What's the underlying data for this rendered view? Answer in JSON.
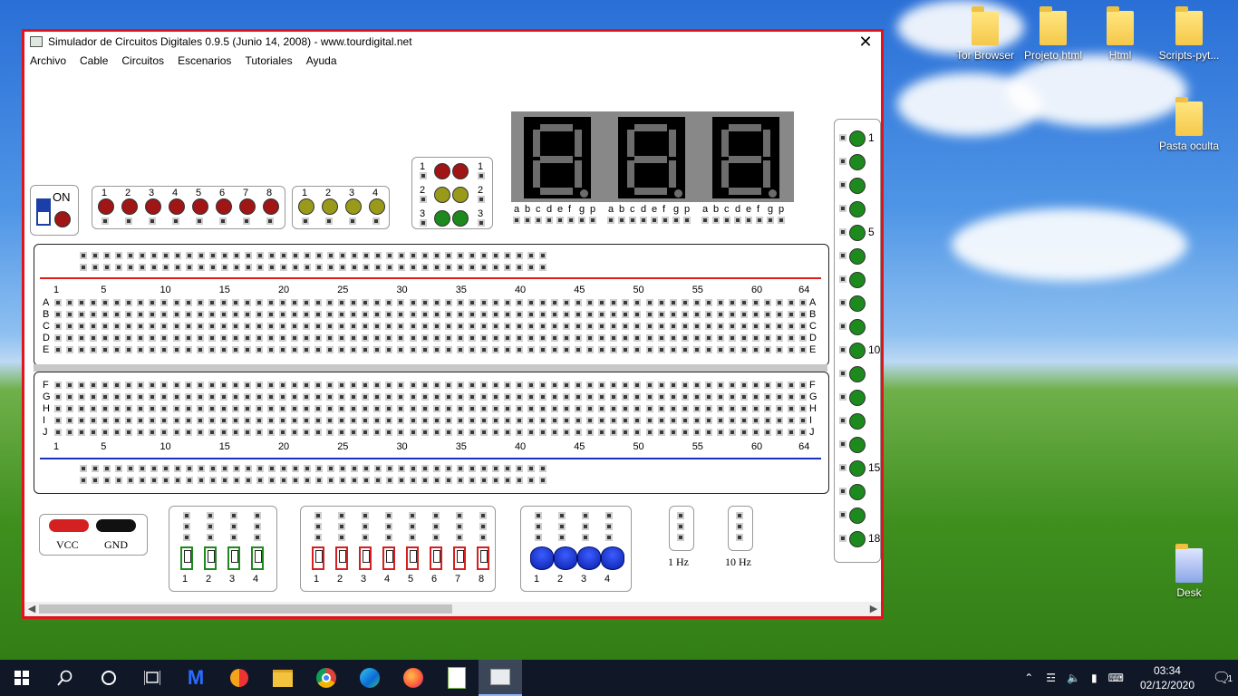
{
  "window": {
    "title": "Simulador de Circuitos Digitales 0.9.5 (Junio 14, 2008) - www.tourdigital.net",
    "close_glyph": "✕",
    "menu": [
      "Archivo",
      "Cable",
      "Circuitos",
      "Escenarios",
      "Tutoriales",
      "Ayuda"
    ]
  },
  "power": {
    "label": "ON"
  },
  "red_leds": {
    "labels": [
      "1",
      "2",
      "3",
      "4",
      "5",
      "6",
      "7",
      "8"
    ],
    "color": "#a01515"
  },
  "yellow_leds": {
    "labels": [
      "1",
      "2",
      "3",
      "4"
    ],
    "color": "#9a9a1a"
  },
  "traffic": {
    "rows": [
      "1",
      "2",
      "3"
    ],
    "colors": [
      "#a01515",
      "#9a9a1a",
      "#1c8a1c"
    ]
  },
  "seven_seg": {
    "displays": 3,
    "segment_labels": [
      "a",
      "b",
      "c",
      "d",
      "e",
      "f",
      "g",
      "p"
    ]
  },
  "breadboard": {
    "column_numbers": [
      "1",
      "5",
      "10",
      "15",
      "20",
      "25",
      "30",
      "35",
      "40",
      "45",
      "50",
      "55",
      "60",
      "64"
    ],
    "top_rows": [
      "A",
      "B",
      "C",
      "D",
      "E"
    ],
    "bottom_rows": [
      "F",
      "G",
      "H",
      "I",
      "J"
    ]
  },
  "side_leds": {
    "count": 18,
    "labels": {
      "1": "1",
      "5": "5",
      "10": "10",
      "15": "15",
      "18": "18"
    },
    "color": "#1c8a1c"
  },
  "power_rail": {
    "vcc": "VCC",
    "gnd": "GND"
  },
  "switches_green": {
    "labels": [
      "1",
      "2",
      "3",
      "4"
    ]
  },
  "switches_red": {
    "labels": [
      "1",
      "2",
      "3",
      "4",
      "5",
      "6",
      "7",
      "8"
    ]
  },
  "push_buttons": {
    "labels": [
      "1",
      "2",
      "3",
      "4"
    ]
  },
  "clocks": [
    {
      "label": "1 Hz"
    },
    {
      "label": "10 Hz"
    }
  ],
  "desktop": {
    "icons": [
      "Tor Browser",
      "Projeto html",
      "Html",
      "Scripts-pyt...",
      "Pasta oculta",
      "Desk"
    ]
  },
  "taskbar": {
    "time": "03:34",
    "date": "02/12/2020",
    "notifications": "1"
  }
}
